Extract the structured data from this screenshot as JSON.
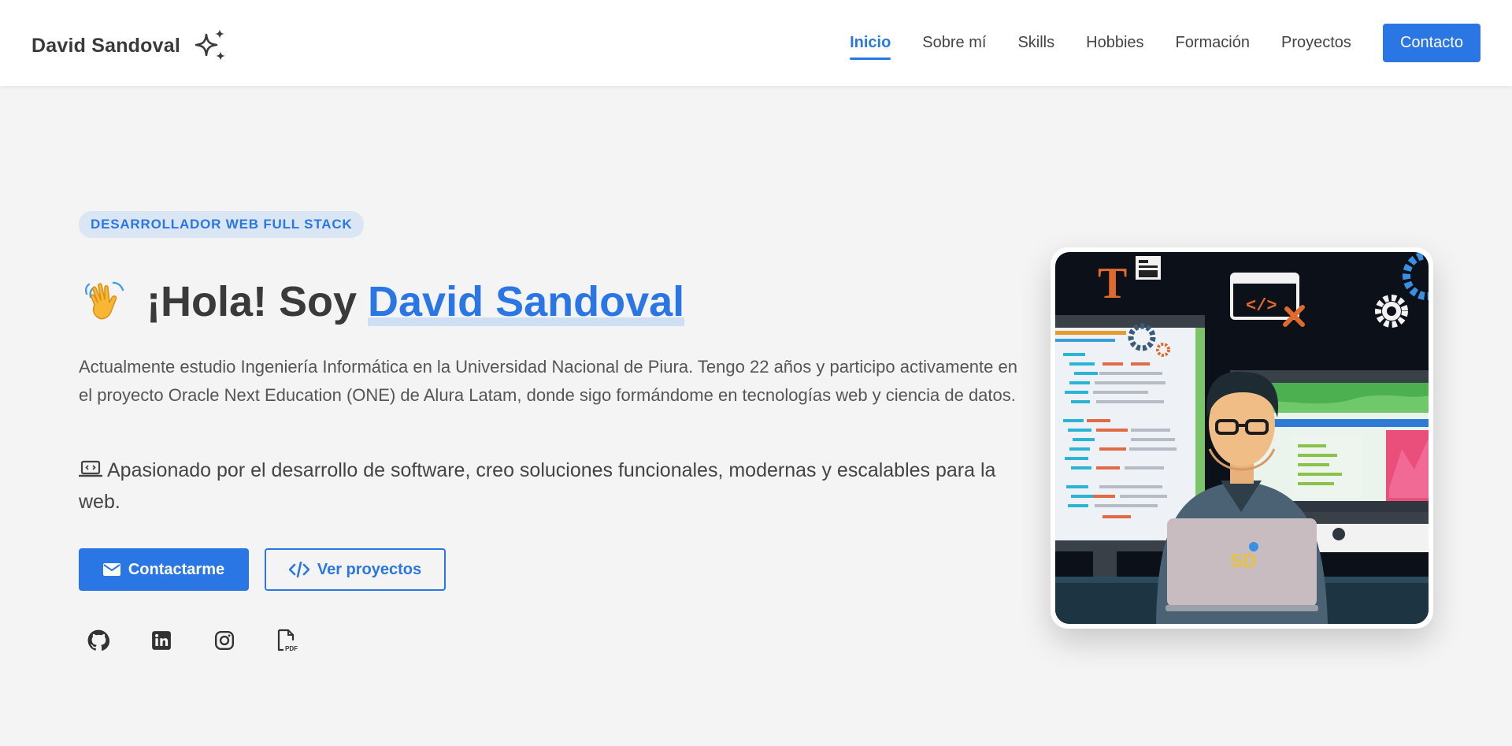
{
  "navbar": {
    "brand": "David Sandoval",
    "brand_icon": "sparkles-icon",
    "links": [
      {
        "label": "Inicio",
        "active": true
      },
      {
        "label": "Sobre mí",
        "active": false
      },
      {
        "label": "Skills",
        "active": false
      },
      {
        "label": "Hobbies",
        "active": false
      },
      {
        "label": "Formación",
        "active": false
      },
      {
        "label": "Proyectos",
        "active": false
      }
    ],
    "cta": "Contacto"
  },
  "hero": {
    "badge": "DESARROLLADOR WEB FULL STACK",
    "greeting": "¡Hola! Soy",
    "name": "David Sandoval",
    "description": "Actualmente estudio Ingeniería Informática en la Universidad Nacional de Piura. Tengo 22 años y participo activamente en el proyecto Oracle Next Education (ONE) de Alura Latam, donde sigo formándome en tecnologías web y ciencia de datos.",
    "passion": "Apasionado por el desarrollo de software, creo soluciones funcionales, modernas y escalables para la web.",
    "buttons": {
      "contact": "Contactarme",
      "projects": "Ver proyectos"
    },
    "socials": [
      "github-icon",
      "linkedin-icon",
      "instagram-icon",
      "pdf-file-icon"
    ]
  },
  "illustration": {
    "laptop_logo": "SD"
  },
  "colors": {
    "accent": "#2b76e5",
    "background": "#f4f4f4",
    "badge_bg": "#dbe6f4"
  }
}
